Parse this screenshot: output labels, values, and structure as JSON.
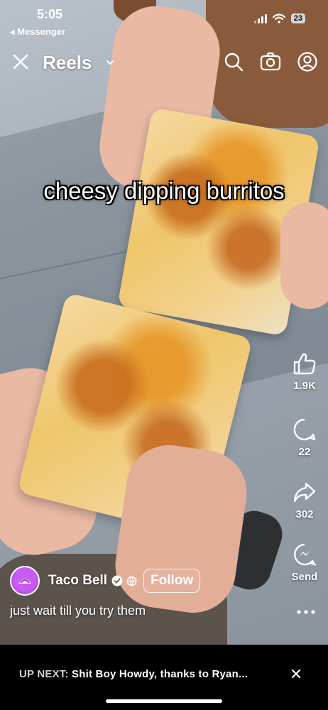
{
  "status_bar": {
    "time": "5:05",
    "back_app": "◂ Messenger",
    "battery": "23"
  },
  "header": {
    "title": "Reels"
  },
  "caption": "cheesy dipping burritos",
  "actions": {
    "likes": "1.9K",
    "comments": "22",
    "shares": "302",
    "send": "Send"
  },
  "account": {
    "name": "Taco Bell",
    "follow_label": "Follow"
  },
  "description": "just wait till you try them",
  "up_next": {
    "label": "UP NEXT:",
    "title": "Shit Boy Howdy, thanks to Ryan..."
  },
  "icons": [
    "close-icon",
    "chevron-down-icon",
    "search-icon",
    "camera-icon",
    "profile-icon",
    "like-icon",
    "comment-icon",
    "share-icon",
    "send-icon",
    "verified-icon",
    "globe-icon",
    "more-icon"
  ]
}
